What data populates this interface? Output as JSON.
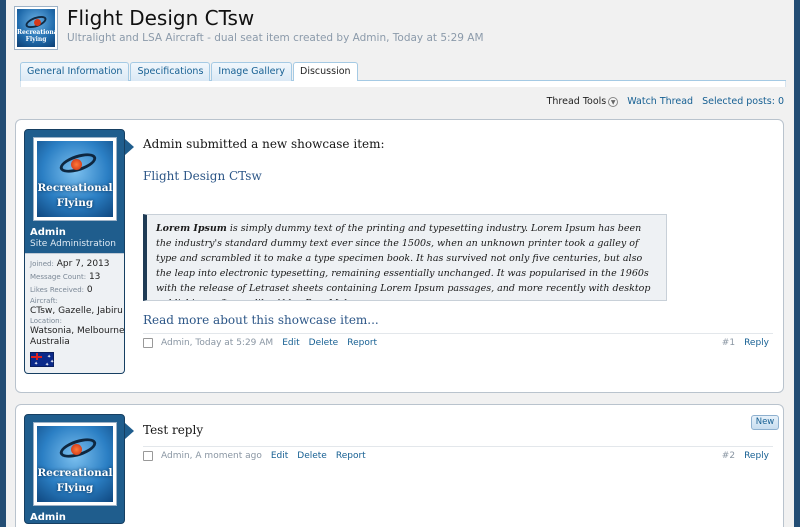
{
  "header": {
    "logo_text": "Recreational Flying",
    "title": "Flight Design CTsw",
    "subtitle": "Ultralight and LSA Aircraft - dual seat item created by Admin, Today at 5:29 AM"
  },
  "tabs": [
    {
      "label": "General Information",
      "active": false
    },
    {
      "label": "Specifications",
      "active": false
    },
    {
      "label": "Image Gallery",
      "active": false
    },
    {
      "label": "Discussion",
      "active": true
    }
  ],
  "toolbar": {
    "thread_tools": "Thread Tools",
    "watch_thread": "Watch Thread",
    "selected_posts": "Selected posts: 0"
  },
  "posts": [
    {
      "avatar_text": "Recreational Flying",
      "username": "Admin",
      "user_title": "Site Administration",
      "joined_label": "Joined:",
      "joined": "Apr 7, 2013",
      "messages_label": "Message Count:",
      "messages": "13",
      "likes_label": "Likes Received:",
      "likes": "0",
      "aircraft_label": "Aircraft:",
      "aircraft": "CTsw, Gazelle, Jabiru",
      "location_label": "Location:",
      "location_line1": "Watsonia, Melbourne",
      "location_line2": "Australia",
      "intro": "Admin submitted a new showcase item:",
      "link": "Flight Design CTsw",
      "quote_bold": "Lorem Ipsum",
      "quote_text": " is simply dummy text of the printing and typesetting industry. Lorem Ipsum has been the industry's standard dummy text ever since the 1500s, when an unknown printer took a galley of type and scrambled it to make a type specimen book. It has survived not only five centuries, but also the leap into electronic typesetting, remaining essentially unchanged. It was popularised in the 1960s with the release of Letraset sheets containing Lorem Ipsum passages, and more recently with desktop publishing software like Aldus PageMaker...",
      "read_more": "Read more about this showcase item...",
      "meta_author": "Admin, Today at 5:29 AM",
      "edit": "Edit",
      "delete": "Delete",
      "report": "Report",
      "number": "#1",
      "reply": "Reply"
    },
    {
      "avatar_text": "Recreational Flying",
      "username": "Admin",
      "badge": "New",
      "message": "Test reply",
      "meta_author": "Admin, A moment ago",
      "edit": "Edit",
      "delete": "Delete",
      "report": "Report",
      "number": "#2",
      "reply": "Reply"
    }
  ]
}
